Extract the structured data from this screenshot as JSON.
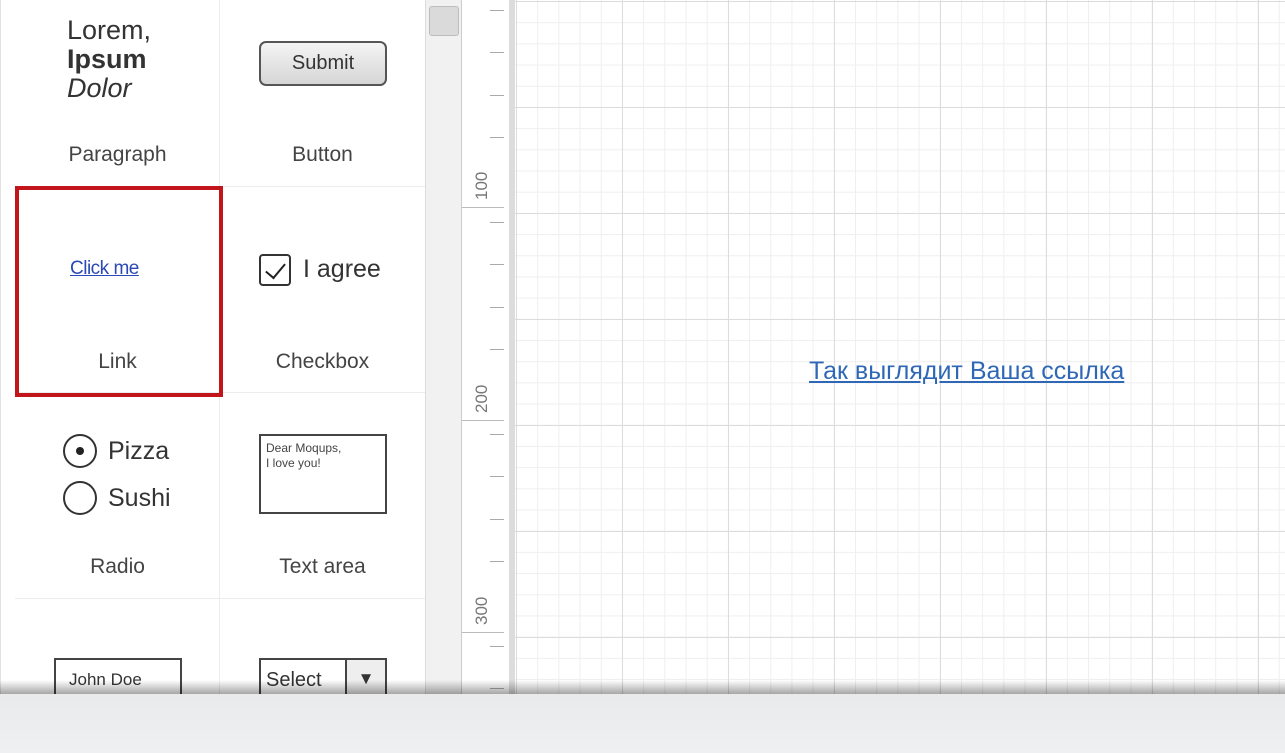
{
  "palette": {
    "paragraph": {
      "line1": "Lorem,",
      "line2": "Ipsum",
      "line3": "Dolor",
      "label": "Paragraph"
    },
    "button": {
      "preview_text": "Submit",
      "label": "Button"
    },
    "link": {
      "preview_text": "Click me",
      "label": "Link",
      "selected": true
    },
    "checkbox": {
      "preview_text": "I agree",
      "checked": true,
      "label": "Checkbox"
    },
    "radio": {
      "options": [
        "Pizza",
        "Sushi"
      ],
      "selected": "Pizza",
      "label": "Radio"
    },
    "text_area": {
      "preview_line1": "Dear Moqups,",
      "preview_line2": "I love you!",
      "label": "Text area"
    },
    "text_input": {
      "preview_text": "John Doe"
    },
    "select": {
      "preview_text": "Select",
      "arrow": "▼"
    }
  },
  "ruler": {
    "labels": [
      "100",
      "200",
      "300"
    ]
  },
  "canvas": {
    "link_text": "Так выглядит Ваша ссылка"
  },
  "colors": {
    "selection": "#c2141b",
    "link": "#2e67b6"
  }
}
